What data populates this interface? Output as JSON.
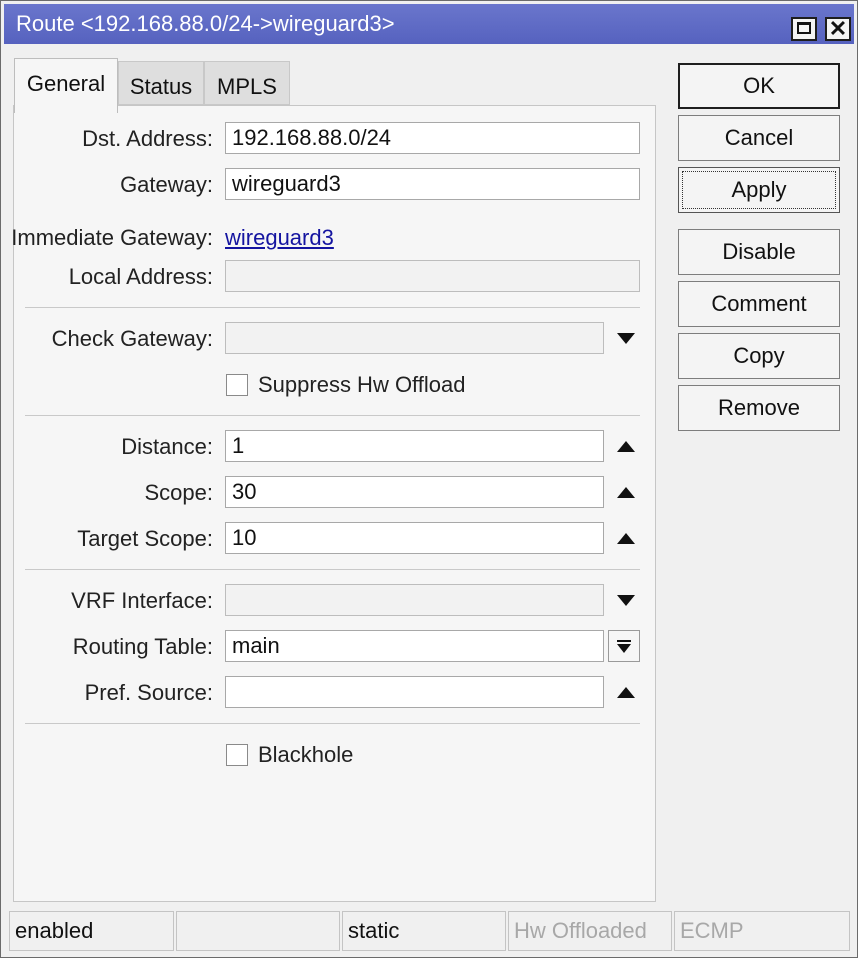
{
  "window": {
    "title": "Route <192.168.88.0/24->wireguard3>"
  },
  "tabs": [
    {
      "label": "General"
    },
    {
      "label": "Status"
    },
    {
      "label": "MPLS"
    }
  ],
  "form": {
    "dst_address": {
      "label": "Dst. Address:",
      "value": "192.168.88.0/24"
    },
    "gateway": {
      "label": "Gateway:",
      "value": "wireguard3"
    },
    "immediate_gateway": {
      "label": "Immediate Gateway:",
      "value": "wireguard3"
    },
    "local_address": {
      "label": "Local Address:",
      "value": ""
    },
    "check_gateway": {
      "label": "Check Gateway:",
      "value": ""
    },
    "suppress_hw_offload": {
      "label": "Suppress Hw Offload",
      "checked": false
    },
    "distance": {
      "label": "Distance:",
      "value": "1"
    },
    "scope": {
      "label": "Scope:",
      "value": "30"
    },
    "target_scope": {
      "label": "Target Scope:",
      "value": "10"
    },
    "vrf_interface": {
      "label": "VRF Interface:",
      "value": ""
    },
    "routing_table": {
      "label": "Routing Table:",
      "value": "main"
    },
    "pref_source": {
      "label": "Pref. Source:",
      "value": ""
    },
    "blackhole": {
      "label": "Blackhole",
      "checked": false
    }
  },
  "buttons": {
    "ok": "OK",
    "cancel": "Cancel",
    "apply": "Apply",
    "disable": "Disable",
    "comment": "Comment",
    "copy": "Copy",
    "remove": "Remove"
  },
  "statusbar": {
    "state": "enabled",
    "empty": "",
    "type": "static",
    "hw_offloaded": "Hw Offloaded",
    "ecmp": "ECMP"
  }
}
